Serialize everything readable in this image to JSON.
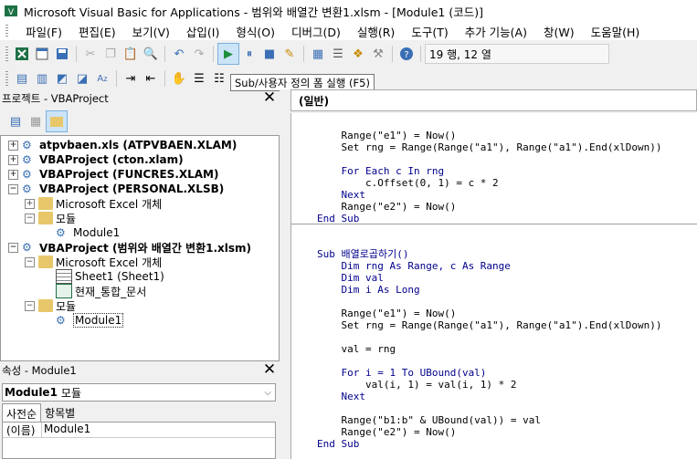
{
  "titlebar": {
    "title": "Microsoft Visual Basic for Applications - 범위와 배열간 변환1.xlsm - [Module1 (코드)]"
  },
  "menubar": {
    "items": [
      "파일(F)",
      "편집(E)",
      "보기(V)",
      "삽입(I)",
      "형식(O)",
      "디버그(D)",
      "실행(R)",
      "도구(T)",
      "추가 기능(A)",
      "창(W)",
      "도움말(H)"
    ]
  },
  "toolbar": {
    "position_text": "19 행, 12 열"
  },
  "tooltip": {
    "text": "Sub/사용자 정의 폼 실행 (F5)"
  },
  "project_panel": {
    "title": "프로젝트 - VBAProject",
    "rows": [
      {
        "label": "atpvbaen.xls (ATPVBAEN.XLAM)",
        "expander": "+"
      },
      {
        "label": "VBAProject (cton.xlam)",
        "expander": "+"
      },
      {
        "label": "VBAProject (FUNCRES.XLAM)",
        "expander": "+"
      },
      {
        "label": "VBAProject (PERSONAL.XLSB)",
        "expander": "−"
      },
      {
        "label": "Microsoft Excel 개체",
        "expander": "+"
      },
      {
        "label": "모듈",
        "expander": "−"
      },
      {
        "label": "Module1",
        "expander": ""
      },
      {
        "label": "VBAProject (범위와 배열간 변환1.xlsm)",
        "expander": "−"
      },
      {
        "label": "Microsoft Excel 개체",
        "expander": "−"
      },
      {
        "label": "Sheet1 (Sheet1)",
        "expander": ""
      },
      {
        "label": "현재_통합_문서",
        "expander": ""
      },
      {
        "label": "모듈",
        "expander": "−"
      },
      {
        "label": "Module1",
        "expander": ""
      }
    ]
  },
  "properties_panel": {
    "title": "속성 - Module1",
    "object_name": "Module1",
    "object_type": "모듈",
    "tabs": [
      "사전순",
      "항목별"
    ],
    "prop_name": "(이름)",
    "prop_value": "Module1"
  },
  "code_window": {
    "object_combo": "(일반)",
    "lines": [
      {
        "text": "    Range(\"e1\") = Now()",
        "kw": false
      },
      {
        "text": "    Set rng = Range(Range(\"a1\"), Range(\"a1\").End(xlDown))",
        "kw": false
      },
      {
        "text": "",
        "kw": false
      },
      {
        "text": "    For Each c In rng",
        "kw": true
      },
      {
        "text": "        c.Offset(0, 1) = c * 2",
        "kw": false
      },
      {
        "text": "    Next",
        "kw": true
      },
      {
        "text": "    Range(\"e2\") = Now()",
        "kw": false
      },
      {
        "text": "End Sub",
        "kw": true
      },
      {
        "text": "",
        "kw": false
      },
      {
        "text": "Sub 배열로곱하기()",
        "kw": true
      },
      {
        "text": "    Dim rng As Range, c As Range",
        "kw": true
      },
      {
        "text": "    Dim val",
        "kw": true
      },
      {
        "text": "    Dim i As Long",
        "kw": true
      },
      {
        "text": "",
        "kw": false
      },
      {
        "text": "    Range(\"e1\") = Now()",
        "kw": false
      },
      {
        "text": "    Set rng = Range(Range(\"a1\"), Range(\"a1\").End(xlDown))",
        "kw": false
      },
      {
        "text": "",
        "kw": false
      },
      {
        "text": "    val = rng",
        "kw": false
      },
      {
        "text": "",
        "kw": false
      },
      {
        "text": "    For i = 1 To UBound(val)",
        "kw": true
      },
      {
        "text": "        val(i, 1) = val(i, 1) * 2",
        "kw": false
      },
      {
        "text": "    Next",
        "kw": true
      },
      {
        "text": "",
        "kw": false
      },
      {
        "text": "    Range(\"b1:b\" & UBound(val)) = val",
        "kw": false
      },
      {
        "text": "    Range(\"e2\") = Now()",
        "kw": false
      },
      {
        "text": "End Sub",
        "kw": true
      }
    ]
  }
}
